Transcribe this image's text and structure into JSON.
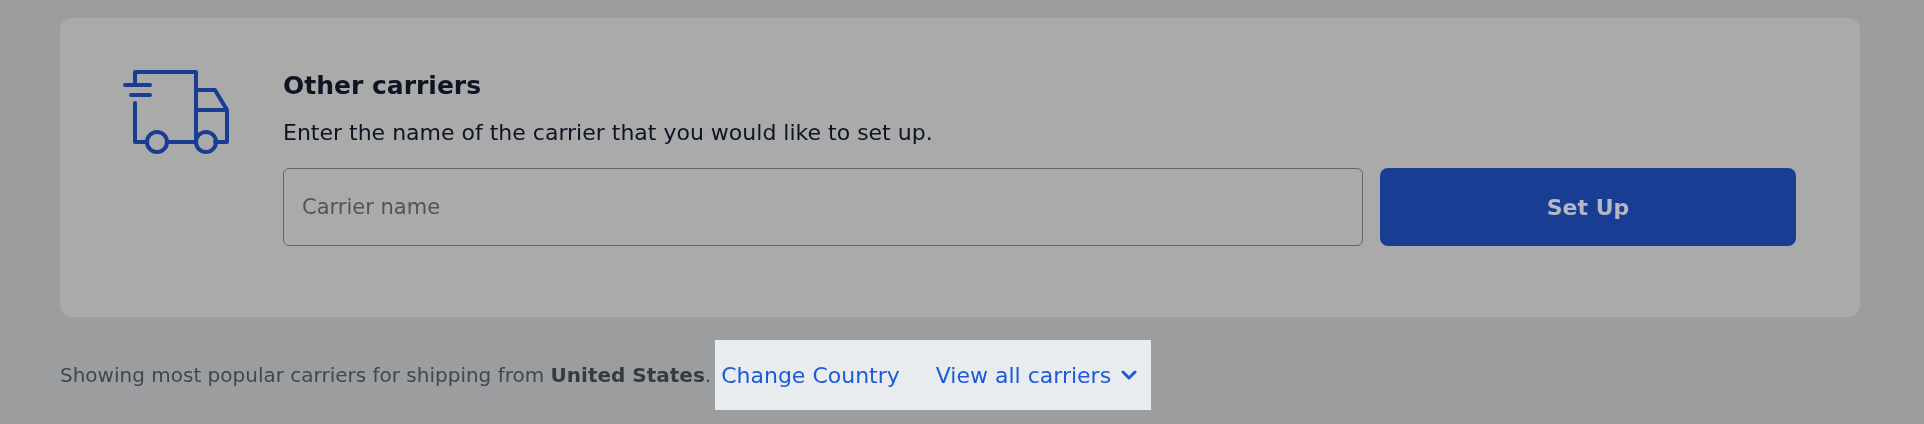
{
  "card": {
    "title": "Other carriers",
    "description": "Enter the name of the carrier that you would like to set up.",
    "carrier_field": {
      "placeholder": "Carrier name"
    },
    "button": "Set Up"
  },
  "footer": {
    "note": "Showing most popular carriers for shipping from **United States**.",
    "links": [
      {
        "label": "Change Country",
        "kind": "link"
      },
      {
        "label": "View all carriers",
        "kind": "dropdown"
      }
    ]
  }
}
